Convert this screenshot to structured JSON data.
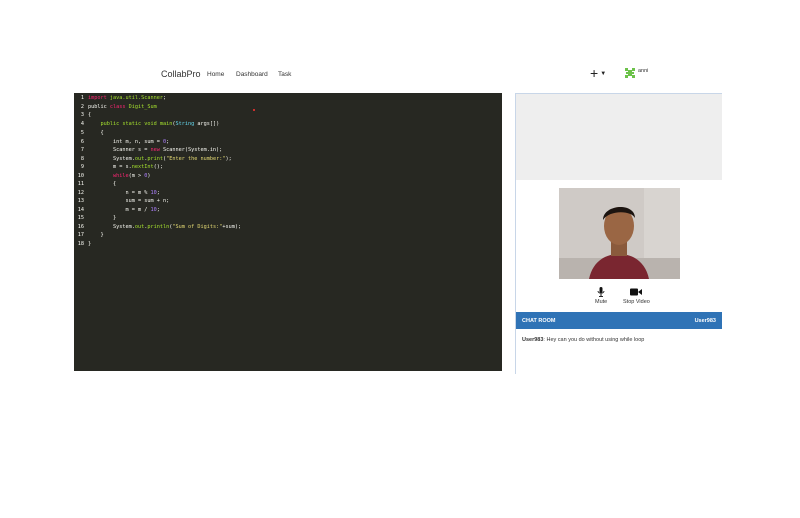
{
  "nav": {
    "brand": "CollabPro",
    "links": [
      "Home",
      "Dashboard",
      "Task"
    ],
    "plus": "+",
    "username": "anni"
  },
  "editor": {
    "lines": [
      "import java.util.Scanner;",
      "public class Digit_Sum",
      "{",
      "    public static void main(String args[])",
      "    {",
      "        int m, n, sum = 0;",
      "        Scanner s = new Scanner(System.in);",
      "        System.out.print(\"Enter the number:\");",
      "        m = s.nextInt();",
      "        while(m > 0)",
      "        {",
      "            n = m % 10;",
      "            sum = sum + n;",
      "            m = m / 10;",
      "        }",
      "        System.out.println(\"Sum of Digits:\"+sum);",
      "    }",
      "}"
    ]
  },
  "video": {
    "mute_label": "Mute",
    "stop_label": "Stop Video"
  },
  "chat": {
    "title": "CHAT ROOM",
    "current_user": "User983",
    "messages": [
      {
        "user": "User983",
        "text": "Hey can you do without using while loop"
      }
    ]
  },
  "colors": {
    "editor_bg": "#272822",
    "chat_header": "#2f73b6",
    "keyword": "#f92672",
    "type": "#66d9ef",
    "function": "#a6e22e",
    "string": "#e6db74",
    "number": "#ae81ff"
  }
}
